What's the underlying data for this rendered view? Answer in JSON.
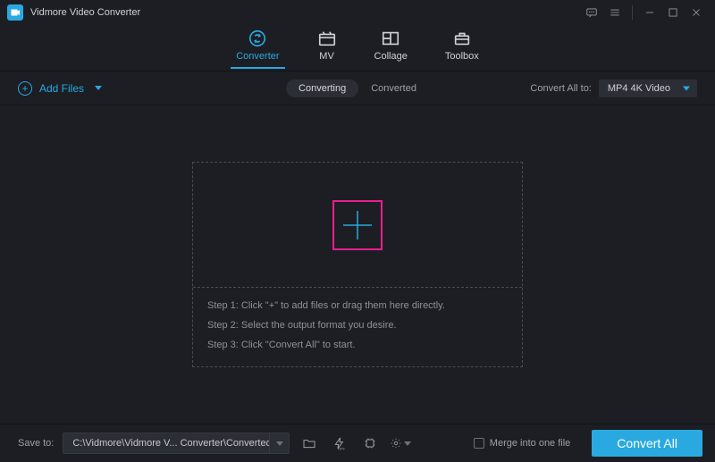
{
  "app": {
    "title": "Vidmore Video Converter"
  },
  "nav": {
    "tabs": [
      {
        "label": "Converter"
      },
      {
        "label": "MV"
      },
      {
        "label": "Collage"
      },
      {
        "label": "Toolbox"
      }
    ]
  },
  "toolbar": {
    "add_files": "Add Files",
    "segments": {
      "converting": "Converting",
      "converted": "Converted"
    },
    "convert_all_to_label": "Convert All to:",
    "format": "MP4 4K Video"
  },
  "dropzone": {
    "step1": "Step 1: Click \"+\" to add files or drag them here directly.",
    "step2": "Step 2: Select the output format you desire.",
    "step3": "Step 3: Click \"Convert All\" to start."
  },
  "footer": {
    "save_to_label": "Save to:",
    "path": "C:\\Vidmore\\Vidmore V... Converter\\Converted",
    "merge_label": "Merge into one file",
    "convert_all": "Convert All"
  }
}
